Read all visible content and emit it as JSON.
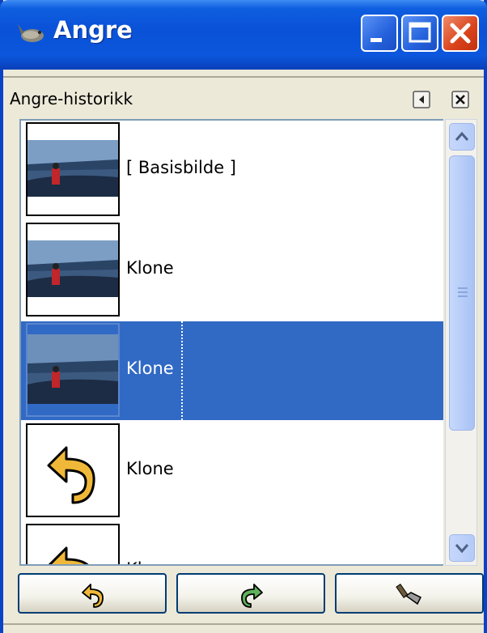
{
  "window": {
    "title": "Angre",
    "controls": [
      "minimize-icon",
      "maximize-icon",
      "close-icon"
    ]
  },
  "panel": {
    "title": "Angre-historikk",
    "menu_icon": "tab-menu-icon",
    "close_icon": "close-icon"
  },
  "history": {
    "items": [
      {
        "label": "[ Basisbilde ]",
        "thumb": "photo",
        "selected": false
      },
      {
        "label": "Klone",
        "thumb": "photo",
        "selected": false
      },
      {
        "label": "Klone",
        "thumb": "photo",
        "selected": true
      },
      {
        "label": "Klone",
        "thumb": "undo-arrow-icon",
        "selected": false
      },
      {
        "label": "Klone",
        "thumb": "undo-arrow-icon",
        "selected": false
      }
    ]
  },
  "buttons": {
    "undo": "undo-icon",
    "redo": "redo-icon",
    "clear": "clear-history-icon"
  },
  "colors": {
    "titlebar": "#0a52d8",
    "selection": "#316ac5",
    "panel_bg": "#ece9d8"
  }
}
